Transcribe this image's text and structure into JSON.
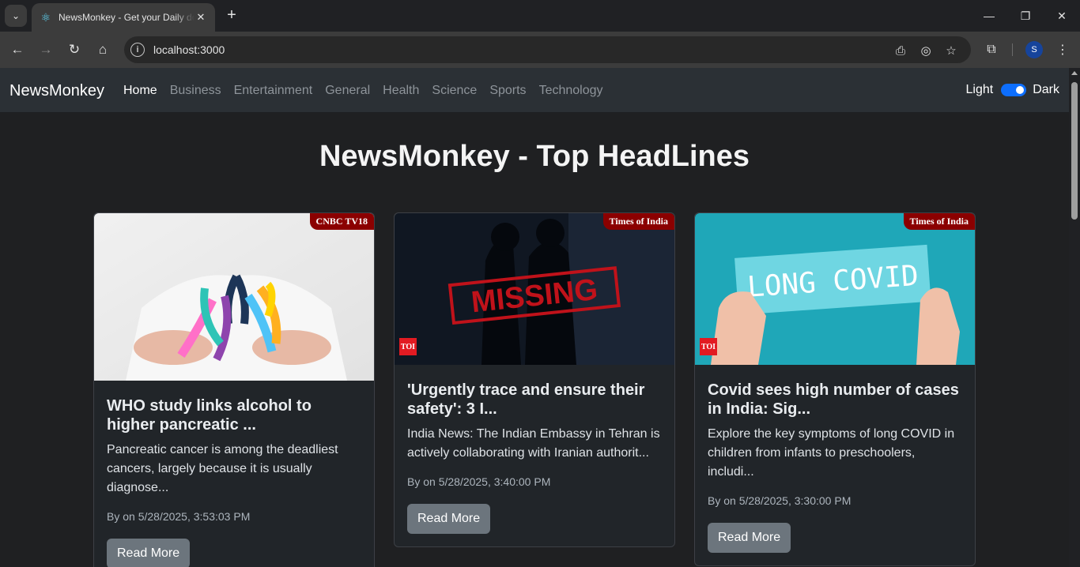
{
  "browser": {
    "tab_title": "NewsMonkey - Get your Daily dose of news",
    "tab_close": "✕",
    "new_tab": "+",
    "url": "localhost:3000",
    "profile_initial": "S"
  },
  "navbar": {
    "brand": "NewsMonkey",
    "links": [
      "Home",
      "Business",
      "Entertainment",
      "General",
      "Health",
      "Science",
      "Sports",
      "Technology"
    ],
    "active_link": "Home",
    "theme_left": "Light",
    "theme_right": "Dark",
    "dark_mode_on": true
  },
  "page": {
    "heading": "NewsMonkey - Top HeadLines"
  },
  "articles": [
    {
      "source": "CNBC TV18",
      "title": "WHO study links alcohol to higher pancreatic ...",
      "description": "Pancreatic cancer is among the deadliest cancers, largely because it is usually diagnose...",
      "meta": "By on 5/28/2025, 3:53:03 PM",
      "button": "Read More"
    },
    {
      "source": "Times of India",
      "title": "'Urgently trace and ensure their safety': 3 I...",
      "description": "India News: The Indian Embassy in Tehran is actively collaborating with Iranian authorit...",
      "meta": "By on 5/28/2025, 3:40:00 PM",
      "button": "Read More",
      "image_text": "MISSING",
      "logo": "TOI"
    },
    {
      "source": "Times of India",
      "title": "Covid sees high number of cases in India: Sig...",
      "description": "Explore the key symptoms of long COVID in children from infants to preschoolers, includi...",
      "meta": "By on 5/28/2025, 3:30:00 PM",
      "button": "Read More",
      "image_text": "LONG COVID",
      "logo": "TOI"
    }
  ]
}
